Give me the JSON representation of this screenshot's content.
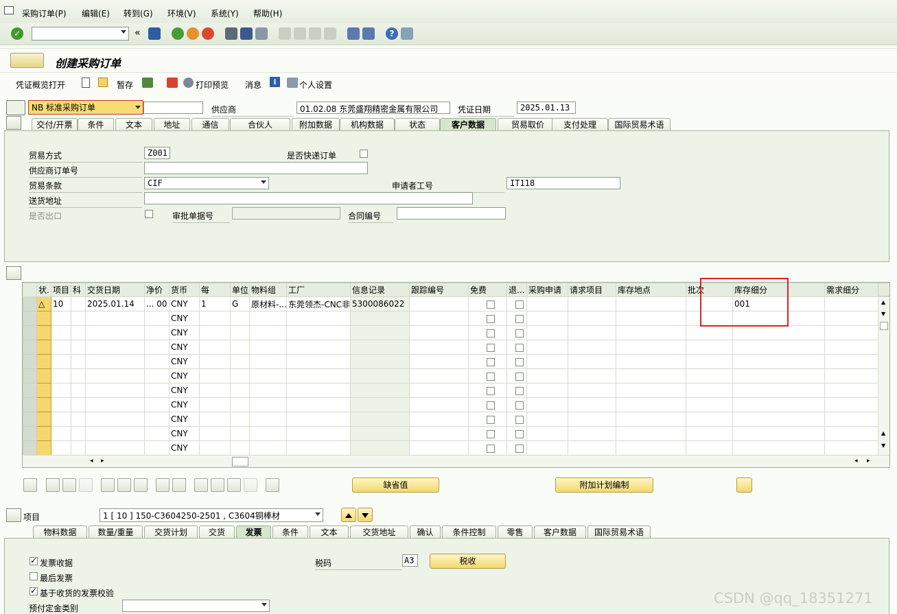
{
  "menu": [
    "采购订单(P)",
    "编辑(E)",
    "转到(G)",
    "环境(V)",
    "系统(Y)",
    "帮助(H)"
  ],
  "title": "创建采购订单",
  "apptoolbar": {
    "overview": "凭证概览打开",
    "hold": "暂存",
    "print_preview": "打印预览",
    "messages": "消息",
    "personal": "个人设置"
  },
  "header": {
    "doc_type": "NB 标准采购订单",
    "vendor_label": "供应商",
    "vendor": "01.02.08 东莞盛翔精密金属有限公司",
    "docdate_label": "凭证日期",
    "docdate": "2025.01.13"
  },
  "header_tabs": [
    "交付/开票",
    "条件",
    "文本",
    "地址",
    "通信",
    "合伙人",
    "附加数据",
    "机构数据",
    "状态",
    "客户数据",
    "贸易取价",
    "支付处理",
    "国际贸易术语"
  ],
  "header_active_tab": 9,
  "cust": {
    "trade_mode_label": "贸易方式",
    "trade_mode": "Z001",
    "express_label": "是否快递订单",
    "vendor_order_label": "供应商订单号",
    "vendor_order": "",
    "terms_label": "贸易条款",
    "terms": "CIF",
    "applicant_label": "申请者工号",
    "applicant": "IT118",
    "ship_addr_label": "送货地址",
    "ship_addr": "",
    "export_label": "是否出口",
    "approval_label": "审批单据号",
    "approval": "",
    "contract_label": "合同编号",
    "contract": ""
  },
  "grid": {
    "columns": [
      "状.",
      "项目",
      "科",
      "交货日期",
      "净价",
      "货币",
      "每",
      "单位",
      "物料组",
      "工厂",
      "信息记录",
      "跟踪编号",
      "免费",
      "退...",
      "采购申请",
      "请求项目",
      "库存地点",
      "批次",
      "库存细分",
      "需求细分"
    ],
    "rows": [
      [
        "",
        "10",
        "",
        "2025.01.14",
        "... 00",
        "CNY",
        "1",
        "G",
        "原材料-...",
        "东莞领杰-CNC非...",
        "5300086022",
        "",
        "",
        "",
        "",
        "",
        "",
        "",
        "001",
        ""
      ],
      [
        "",
        "",
        "",
        "",
        "",
        "CNY",
        "",
        "",
        "",
        "",
        "",
        "",
        "",
        "",
        "",
        "",
        "",
        "",
        "",
        ""
      ],
      [
        "",
        "",
        "",
        "",
        "",
        "CNY",
        "",
        "",
        "",
        "",
        "",
        "",
        "",
        "",
        "",
        "",
        "",
        "",
        "",
        ""
      ],
      [
        "",
        "",
        "",
        "",
        "",
        "CNY",
        "",
        "",
        "",
        "",
        "",
        "",
        "",
        "",
        "",
        "",
        "",
        "",
        "",
        ""
      ],
      [
        "",
        "",
        "",
        "",
        "",
        "CNY",
        "",
        "",
        "",
        "",
        "",
        "",
        "",
        "",
        "",
        "",
        "",
        "",
        "",
        ""
      ],
      [
        "",
        "",
        "",
        "",
        "",
        "CNY",
        "",
        "",
        "",
        "",
        "",
        "",
        "",
        "",
        "",
        "",
        "",
        "",
        "",
        ""
      ],
      [
        "",
        "",
        "",
        "",
        "",
        "CNY",
        "",
        "",
        "",
        "",
        "",
        "",
        "",
        "",
        "",
        "",
        "",
        "",
        "",
        ""
      ],
      [
        "",
        "",
        "",
        "",
        "",
        "CNY",
        "",
        "",
        "",
        "",
        "",
        "",
        "",
        "",
        "",
        "",
        "",
        "",
        "",
        ""
      ],
      [
        "",
        "",
        "",
        "",
        "",
        "CNY",
        "",
        "",
        "",
        "",
        "",
        "",
        "",
        "",
        "",
        "",
        "",
        "",
        "",
        ""
      ],
      [
        "",
        "",
        "",
        "",
        "",
        "CNY",
        "",
        "",
        "",
        "",
        "",
        "",
        "",
        "",
        "",
        "",
        "",
        "",
        "",
        ""
      ],
      [
        "",
        "",
        "",
        "",
        "",
        "CNY",
        "",
        "",
        "",
        "",
        "",
        "",
        "",
        "",
        "",
        "",
        "",
        "",
        "",
        ""
      ]
    ]
  },
  "btn_default": "缺省值",
  "btn_schedule": "附加计划编制",
  "item": {
    "label": "项目",
    "value": "1 [ 10 ] 150-C3604250-2501 , C3604铜棒材"
  },
  "item_tabs": [
    "物料数据",
    "数量/重量",
    "交货计划",
    "交货",
    "发票",
    "条件",
    "文本",
    "交货地址",
    "确认",
    "条件控制",
    "零售",
    "客户数据",
    "国际贸易术语"
  ],
  "item_active_tab": 4,
  "invoice": {
    "gr_label": "发票收据",
    "final_label": "最后发票",
    "grbased_label": "基于收货的发票校验",
    "prepay_label": "预付定金类别",
    "prepay": "",
    "tax_label": "税码",
    "tax": "A3",
    "tax_btn": "税收"
  },
  "watermark": "CSDN @qq_18351271",
  "colors": {
    "accent": "#f2d86e",
    "highlight": "#e02020"
  }
}
